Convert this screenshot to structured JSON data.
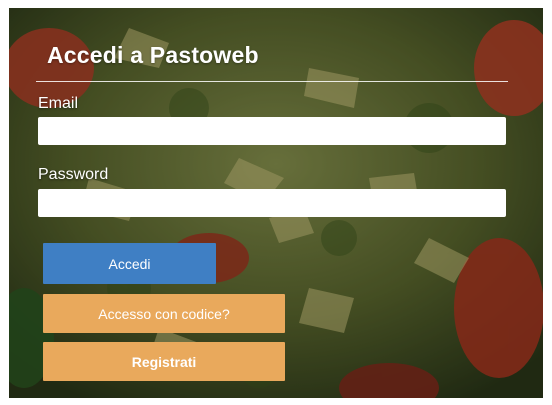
{
  "login": {
    "title": "Accedi a Pastoweb",
    "email_label": "Email",
    "email_value": "",
    "password_label": "Password",
    "password_value": "",
    "login_button": "Accedi",
    "code_login_button": "Accesso con codice?",
    "register_button": "Registrati"
  },
  "colors": {
    "primary_button": "#3f7fc4",
    "secondary_button": "#e9a95c",
    "text": "#ffffff"
  }
}
